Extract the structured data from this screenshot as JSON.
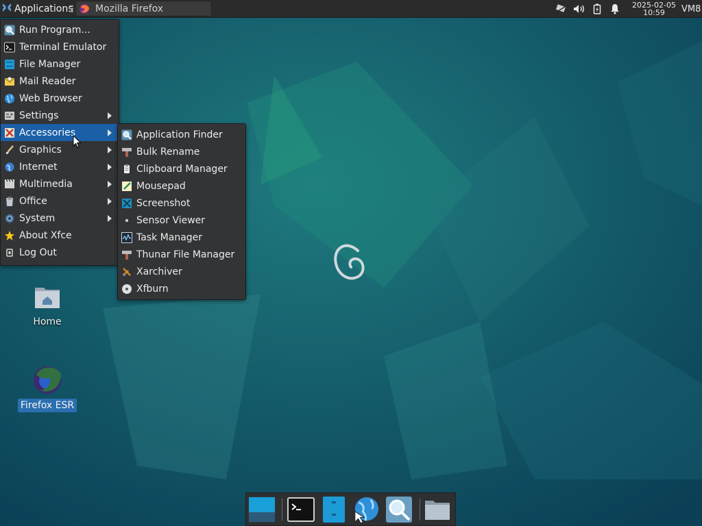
{
  "top_panel": {
    "applications_label": "Applications",
    "task_title": "Mozilla Firefox",
    "clock_date": "2025-02-05",
    "clock_time": "10:59",
    "vm_label": "VM8",
    "tray_icons": [
      "network-icon",
      "volume-icon",
      "battery-icon",
      "notification-bell-icon"
    ]
  },
  "main_menu": {
    "items": [
      {
        "label": "Run Program...",
        "icon": "search-icon",
        "submenu": false
      },
      {
        "label": "Terminal Emulator",
        "icon": "terminal-icon",
        "submenu": false
      },
      {
        "label": "File Manager",
        "icon": "file-manager-icon",
        "submenu": false
      },
      {
        "label": "Mail Reader",
        "icon": "mail-icon",
        "submenu": false
      },
      {
        "label": "Web Browser",
        "icon": "globe-icon",
        "submenu": false
      },
      {
        "label": "Settings",
        "icon": "settings-icon",
        "submenu": true
      },
      {
        "label": "Accessories",
        "icon": "accessories-icon",
        "submenu": true,
        "active": true
      },
      {
        "label": "Graphics",
        "icon": "brush-icon",
        "submenu": true
      },
      {
        "label": "Internet",
        "icon": "internet-icon",
        "submenu": true
      },
      {
        "label": "Multimedia",
        "icon": "film-icon",
        "submenu": true
      },
      {
        "label": "Office",
        "icon": "office-icon",
        "submenu": true
      },
      {
        "label": "System",
        "icon": "gear-icon",
        "submenu": true
      },
      {
        "label": "About Xfce",
        "icon": "star-icon",
        "submenu": false
      },
      {
        "label": "Log Out",
        "icon": "logout-icon",
        "submenu": false
      }
    ]
  },
  "accessories_submenu": {
    "items": [
      {
        "label": "Application Finder",
        "icon": "magnifier-icon"
      },
      {
        "label": "Bulk Rename",
        "icon": "rename-icon"
      },
      {
        "label": "Clipboard Manager",
        "icon": "clipboard-icon"
      },
      {
        "label": "Mousepad",
        "icon": "text-editor-icon"
      },
      {
        "label": "Screenshot",
        "icon": "screenshot-icon"
      },
      {
        "label": "Sensor Viewer",
        "icon": "sensor-icon"
      },
      {
        "label": "Task Manager",
        "icon": "task-manager-icon"
      },
      {
        "label": "Thunar File Manager",
        "icon": "thunar-icon"
      },
      {
        "label": "Xarchiver",
        "icon": "archive-icon"
      },
      {
        "label": "Xfburn",
        "icon": "disc-icon"
      }
    ]
  },
  "desktop_icons": [
    {
      "label": "Home",
      "icon": "home-folder-icon",
      "selected": false
    },
    {
      "label": "Firefox ESR",
      "icon": "firefox-icon",
      "selected": true
    }
  ],
  "dock": {
    "items": [
      "show-desktop-icon",
      "terminal-icon",
      "file-manager-icon",
      "web-browser-icon",
      "app-finder-icon",
      "folder-icon"
    ]
  },
  "colors": {
    "panel_bg": "#2b2b2b",
    "menu_bg": "#333436",
    "menu_highlight": "#1b5fa7",
    "desktop_bg": "#0e4c5e"
  }
}
